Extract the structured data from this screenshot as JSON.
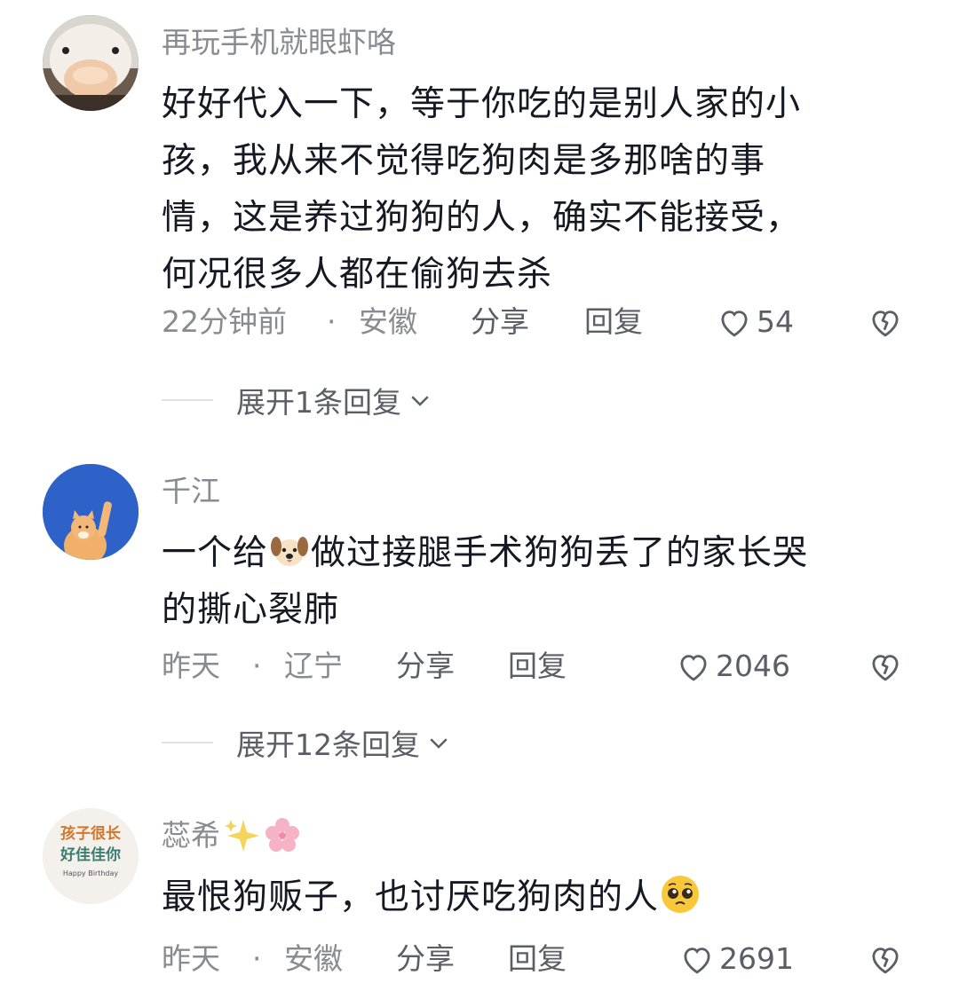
{
  "comments": [
    {
      "username": "再玩手机就眼虾咯",
      "text_lines": [
        "好好代入一下，等于你吃的是别人家的小",
        "孩，我从来不觉得吃狗肉是多那啥的事",
        "情，这是养过狗狗的人，确实不能接受，",
        "何况很多人都在偷狗去杀"
      ],
      "time": "22分钟前",
      "dot": "·",
      "location": "安徽",
      "share_label": "分享",
      "reply_label": "回复",
      "likes": "54",
      "expand_label": "展开1条回复"
    },
    {
      "username": "千江",
      "text_before_emoji": "一个给",
      "text_after_emoji": "做过接腿手术狗狗丢了的家长哭",
      "text_line2": "的撕心裂肺",
      "time": "昨天",
      "dot": "·",
      "location": "辽宁",
      "share_label": "分享",
      "reply_label": "回复",
      "likes": "2046",
      "expand_label": "展开12条回复"
    },
    {
      "username": "蕊希",
      "text": "最恨狗贩子，也讨厌吃狗肉的人",
      "time": "昨天",
      "dot": "·",
      "location": "安徽",
      "share_label": "分享",
      "reply_label": "回复",
      "likes": "2691"
    }
  ],
  "avatar3_text": {
    "line1": "孩子很长",
    "line2": "好佳佳你",
    "line3": "Happy Birthday"
  }
}
